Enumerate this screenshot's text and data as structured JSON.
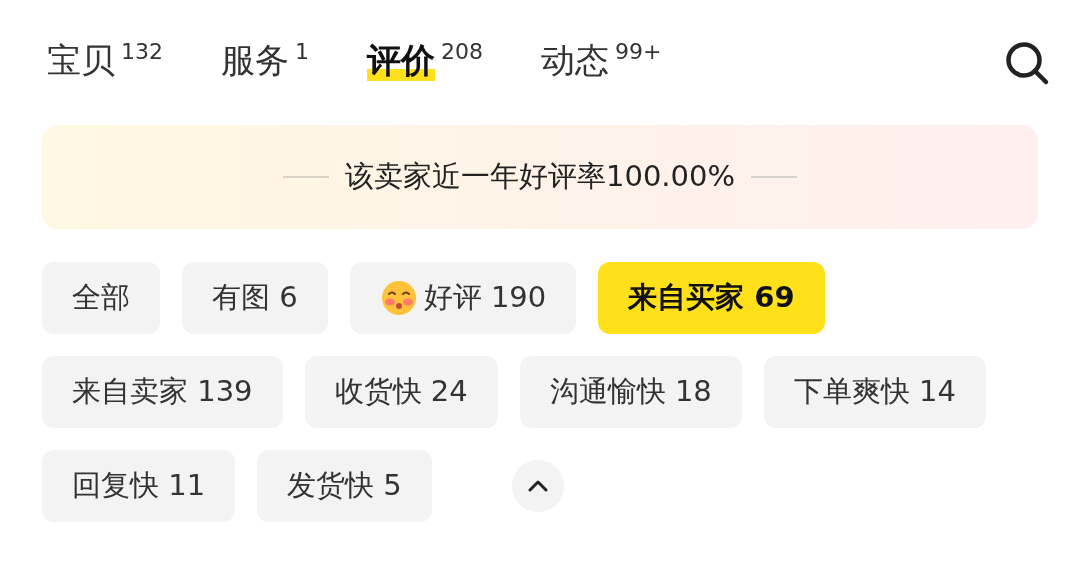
{
  "tabs": [
    {
      "label": "宝贝",
      "count": "132",
      "selected": false
    },
    {
      "label": "服务",
      "count": "1",
      "selected": false
    },
    {
      "label": "评价",
      "count": "208",
      "selected": true
    },
    {
      "label": "动态",
      "count": "99+",
      "selected": false
    }
  ],
  "banner": {
    "text": "该卖家近一年好评率100.00%"
  },
  "filters": [
    {
      "kind": "text",
      "label": "全部",
      "selected": false
    },
    {
      "kind": "text",
      "label": "有图 6",
      "selected": false
    },
    {
      "kind": "emoji",
      "label": "好评 190",
      "selected": false
    },
    {
      "kind": "text",
      "label": "来自买家 69",
      "selected": true
    },
    {
      "kind": "text",
      "label": "来自卖家 139",
      "selected": false
    },
    {
      "kind": "text",
      "label": "收货快 24",
      "selected": false
    },
    {
      "kind": "text",
      "label": "沟通愉快 18",
      "selected": false
    },
    {
      "kind": "text",
      "label": "下单爽快 14",
      "selected": false
    },
    {
      "kind": "text",
      "label": "回复快 11",
      "selected": false
    },
    {
      "kind": "text",
      "label": "发货快 5",
      "selected": false
    }
  ],
  "filters_expanded": true
}
